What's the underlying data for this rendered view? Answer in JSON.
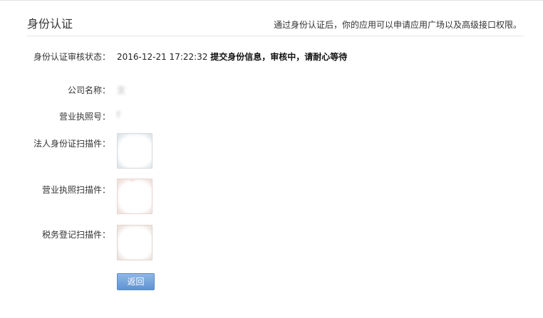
{
  "header": {
    "title": "身份认证",
    "note": "通过身份认证后，你的应用可以申请应用广场以及高级接口权限。"
  },
  "fields": {
    "status": {
      "label": "身份认证审核状态：",
      "time": "2016-12-21 17:22:32",
      "message": "提交身份信息，审核中，请耐心等待"
    },
    "company": {
      "label": "公司名称：",
      "value": "文"
    },
    "license_no": {
      "label": "营业执照号：",
      "value": "f"
    },
    "id_scan": {
      "label": "法人身份证扫描件："
    },
    "license_scan": {
      "label": "营业执照扫描件："
    },
    "tax_scan": {
      "label": "税务登记扫描件："
    }
  },
  "actions": {
    "back_label": "返回"
  }
}
